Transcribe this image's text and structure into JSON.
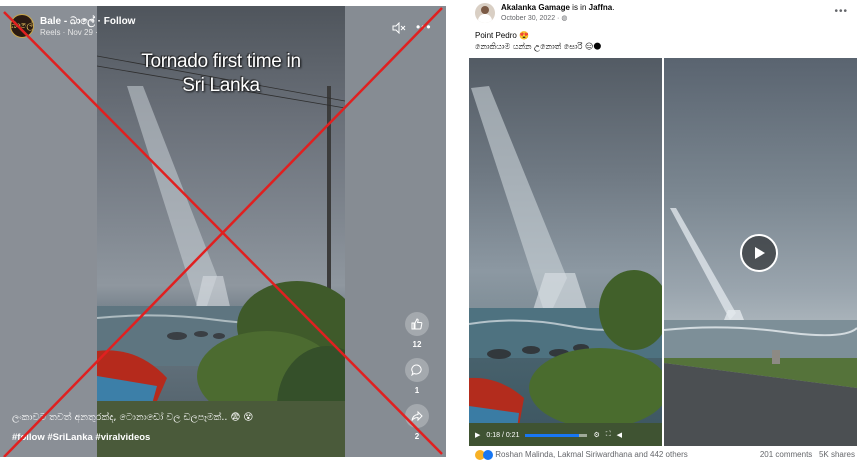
{
  "reel": {
    "page_name": "Bale - බාලේ",
    "follow": "Follow",
    "separator": "·",
    "source": "Reels · Nov 29 ·",
    "avatar_text": "බාලේ",
    "overlay_title_line1": "Tornado first time in",
    "overlay_title_line2": "Sri Lanka",
    "likes_count": "12",
    "comments_count": "1",
    "shares_count": "2",
    "caption": "ලංකාවට තවත් අනතුරක්ද, ටොනාඩෝ වල ඩලපෑමක්.. 😨 😵",
    "hashtags": "#follow #SriLanka #viralvideos",
    "icons": [
      "mute-icon",
      "more-icon",
      "like-icon",
      "comment-icon",
      "share-icon"
    ],
    "cross_color": "#e02020"
  },
  "post": {
    "author": "Akalanka Gamage",
    "is_in": "is in",
    "place": "Jaffna",
    "date": "October 30, 2022 ·",
    "text_line1": "Point Pedro 😍",
    "text_line2": "නොකියාම යන්න උනොත් සොරි 😑🌑",
    "time_display": "0:18 / 0:21",
    "progress_fraction": 0.857,
    "reactions_names": "Roshan Malinda, Lakmal Siriwardhana and 442 others",
    "comments": "201 comments",
    "shares": "5K shares",
    "brand_color": "#1877f2"
  }
}
